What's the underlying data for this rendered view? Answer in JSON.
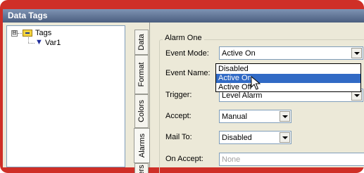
{
  "window": {
    "title": "Data Tags"
  },
  "tree": {
    "root": {
      "label": "Tags",
      "expander": "⊟",
      "icon": "tags-folder-icon"
    },
    "child": {
      "label": "Var1",
      "icon": "flag-icon"
    }
  },
  "tabs": [
    {
      "label": "Data"
    },
    {
      "label": "Format"
    },
    {
      "label": "Colors"
    },
    {
      "label": "Alarms",
      "active": true
    },
    {
      "label": "ers"
    }
  ],
  "alarm_one": {
    "group_label": "Alarm One",
    "event_mode": {
      "label": "Event Mode:",
      "value": "Active On"
    },
    "event_name": {
      "label": "Event Name:"
    },
    "trigger": {
      "label": "Trigger:",
      "value": "Level Alarm"
    },
    "accept": {
      "label": "Accept:",
      "value": "Manual"
    },
    "mail_to": {
      "label": "Mail To:",
      "value": "Disabled"
    },
    "on_accept": {
      "label": "On Accept:",
      "value": "None"
    }
  },
  "dropdown": {
    "options": [
      "Disabled",
      "Active On",
      "Active Off"
    ],
    "selected_index": 1
  },
  "colors": {
    "title_bar": "#4b5e7f",
    "frame": "#cf2f27",
    "selection": "#316ac5"
  }
}
